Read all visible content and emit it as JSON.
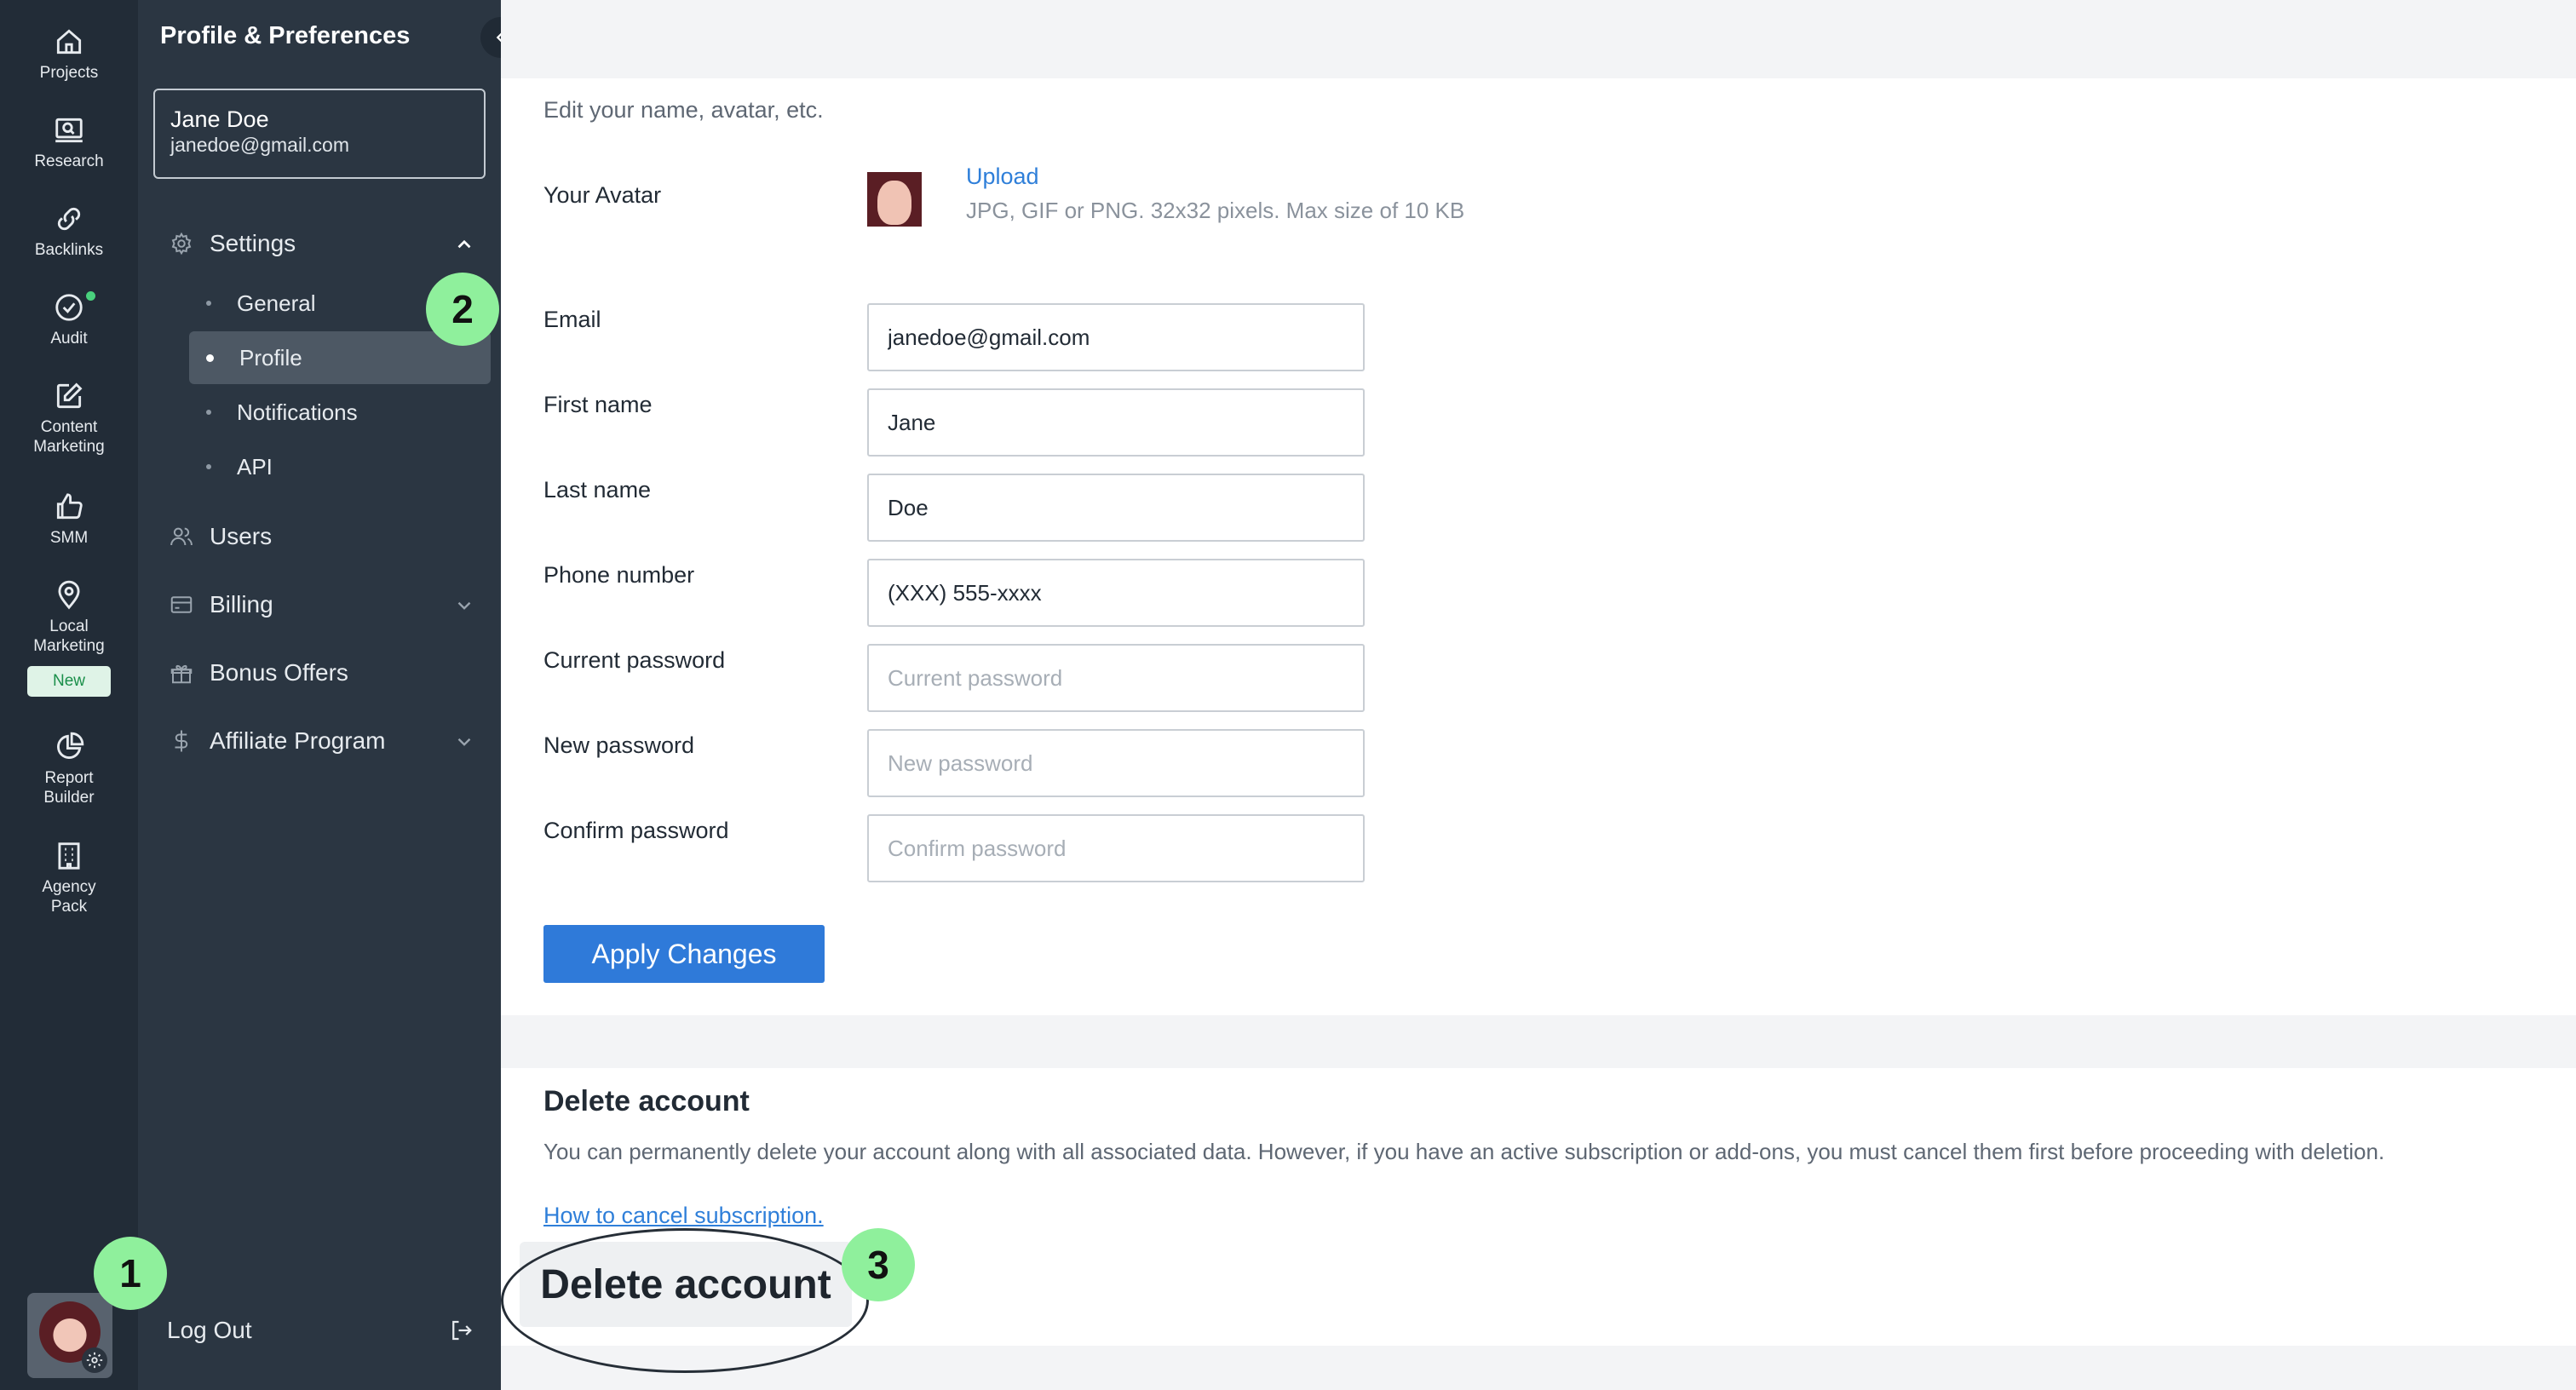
{
  "rail": {
    "items": [
      {
        "label": "Projects",
        "icon": "home-icon"
      },
      {
        "label": "Research",
        "icon": "research-icon"
      },
      {
        "label": "Backlinks",
        "icon": "link-icon"
      },
      {
        "label": "Audit",
        "icon": "check-circle-icon"
      },
      {
        "label": "Content\nMarketing",
        "icon": "edit-icon"
      },
      {
        "label": "SMM",
        "icon": "thumbs-up-icon"
      },
      {
        "label": "Local\nMarketing",
        "icon": "location-pin-icon",
        "badge": "New"
      },
      {
        "label": "Report\nBuilder",
        "icon": "pie-chart-icon"
      },
      {
        "label": "Agency\nPack",
        "icon": "building-icon"
      }
    ],
    "accent_dot": "#49d17d"
  },
  "sidebar": {
    "title": "Profile & Preferences",
    "account": {
      "name": "Jane Doe",
      "email": "janedoe@gmail.com"
    },
    "settings": {
      "label": "Settings",
      "items": [
        {
          "label": "General"
        },
        {
          "label": "Profile",
          "active": true
        },
        {
          "label": "Notifications"
        },
        {
          "label": "API"
        }
      ]
    },
    "users": "Users",
    "billing": "Billing",
    "bonus": "Bonus Offers",
    "affiliate": "Affiliate Program",
    "logout": "Log Out"
  },
  "profile": {
    "subtitle": "Edit your name, avatar, etc.",
    "avatar_label": "Your Avatar",
    "upload": "Upload",
    "upload_hint": "JPG, GIF or PNG. 32x32 pixels. Max size of 10 KB",
    "email_label": "Email",
    "email_value": "janedoe@gmail.com",
    "first_label": "First name",
    "first_value": "Jane",
    "last_label": "Last name",
    "last_value": "Doe",
    "phone_label": "Phone number",
    "phone_value": "(XXX) 555-xxxx",
    "current_label": "Current password",
    "current_placeholder": "Current password",
    "new_label": "New password",
    "new_placeholder": "New password",
    "confirm_label": "Confirm password",
    "confirm_placeholder": "Confirm password",
    "apply": "Apply Changes"
  },
  "delete": {
    "title": "Delete account",
    "description": "You can permanently delete your account along with all associated data. However, if you have an active subscription or add-ons, you must cancel them first before proceeding with deletion.",
    "cancel_link": "How to cancel subscription.",
    "button": "Delete account"
  },
  "steps": [
    "1",
    "2",
    "3"
  ],
  "colors": {
    "primary": "#2f7ad9",
    "link": "#2f7fd9",
    "step_badge": "#8ff09c",
    "sidebar": "#2b3642",
    "rail": "#222c37"
  }
}
